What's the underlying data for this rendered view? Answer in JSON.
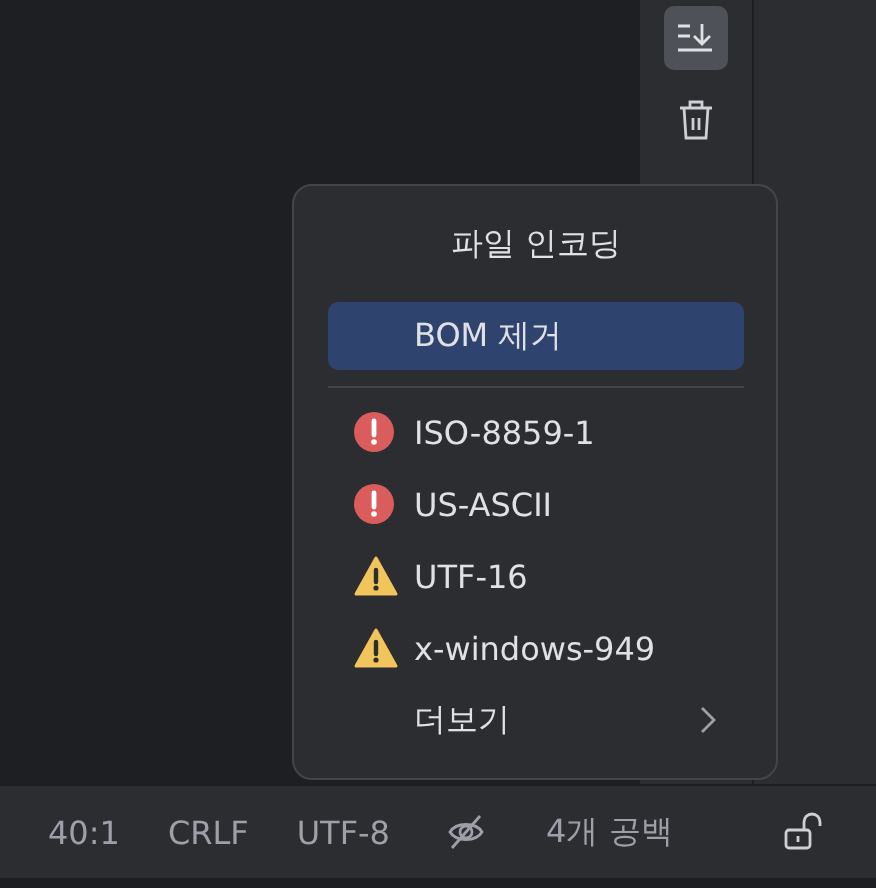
{
  "popup": {
    "title": "파일 인코딩",
    "items": [
      {
        "kind": "action",
        "label": "BOM 제거",
        "selected": true
      },
      {
        "kind": "separator"
      },
      {
        "kind": "error",
        "label": "ISO-8859-1",
        "selected": false
      },
      {
        "kind": "error",
        "label": "US-ASCII",
        "selected": false
      },
      {
        "kind": "warning",
        "label": "UTF-16",
        "selected": false
      },
      {
        "kind": "warning",
        "label": "x-windows-949",
        "selected": false
      },
      {
        "kind": "submenu",
        "label": "더보기",
        "selected": false
      }
    ]
  },
  "status_bar": {
    "position": "40:1",
    "line_separator": "CRLF",
    "encoding": "UTF-8",
    "indent": "4개 공백"
  }
}
